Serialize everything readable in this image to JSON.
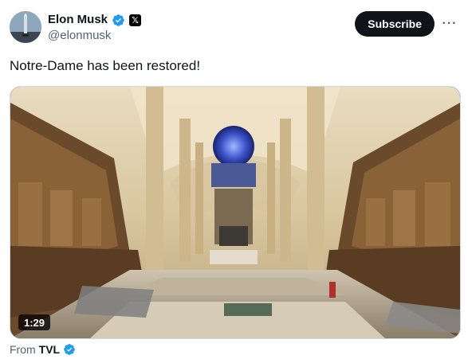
{
  "author": {
    "name": "Elon Musk",
    "handle": "@elonmusk",
    "x_badge": "𝕏"
  },
  "subscribe_label": "Subscribe",
  "more_label": "···",
  "tweet": {
    "text": "Notre-Dame has been restored!"
  },
  "media": {
    "duration": "1:29"
  },
  "source": {
    "prefix": "From",
    "name": "TVL"
  },
  "colors": {
    "verified": "#1d9bf0",
    "subscribe_bg": "#0f1419",
    "secondary_text": "#536471"
  },
  "icons": {
    "verified": "verified-badge-icon",
    "more": "more-options-icon"
  }
}
